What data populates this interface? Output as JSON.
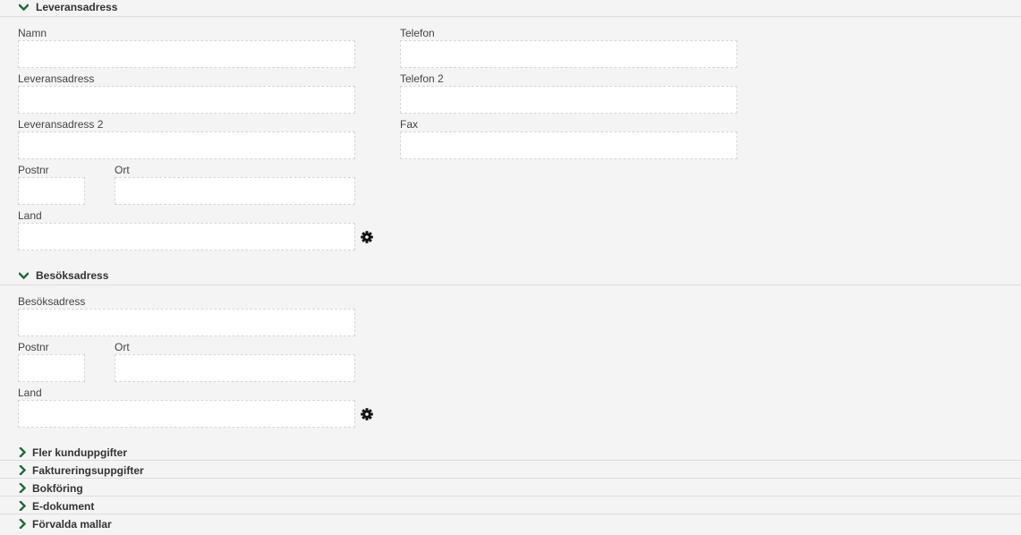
{
  "delivery": {
    "title": "Leveransadress",
    "name_label": "Namn",
    "name_value": "",
    "phone_label": "Telefon",
    "phone_value": "",
    "address_label": "Leveransadress",
    "address_value": "",
    "phone2_label": "Telefon 2",
    "phone2_value": "",
    "address2_label": "Leveransadress 2",
    "address2_value": "",
    "fax_label": "Fax",
    "fax_value": "",
    "postnr_label": "Postnr",
    "postnr_value": "",
    "ort_label": "Ort",
    "ort_value": "",
    "land_label": "Land",
    "land_value": ""
  },
  "visit": {
    "title": "Besöksadress",
    "address_label": "Besöksadress",
    "address_value": "",
    "postnr_label": "Postnr",
    "postnr_value": "",
    "ort_label": "Ort",
    "ort_value": "",
    "land_label": "Land",
    "land_value": ""
  },
  "collapsed_sections": [
    "Fler kunduppgifter",
    "Faktureringsuppgifter",
    "Bokföring",
    "E-dokument",
    "Förvalda mallar"
  ],
  "icons": {
    "expanded": "chevron-down-icon",
    "collapsed": "chevron-right-icon",
    "settings": "gear-icon"
  },
  "colors": {
    "accent": "#1e6b3a",
    "background": "#f4f4f4",
    "field_border": "#d6d6d6"
  }
}
